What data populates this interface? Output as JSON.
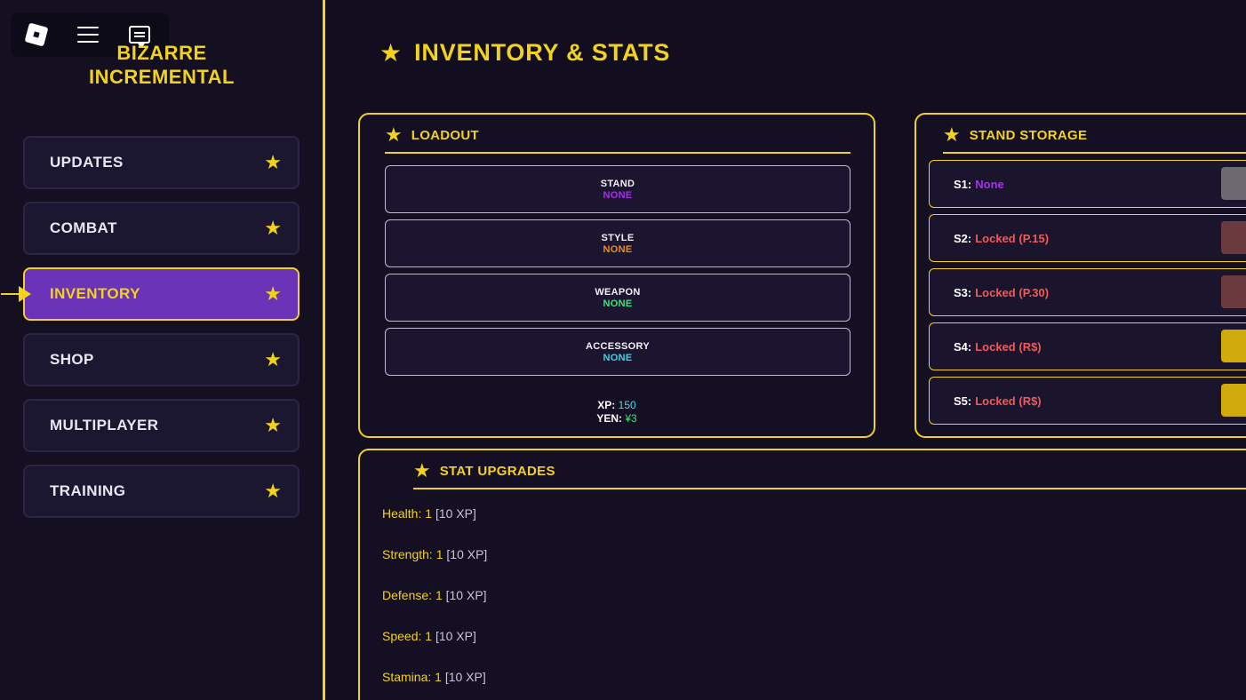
{
  "app": {
    "title": "BIZARRE INCREMENTAL"
  },
  "colors": {
    "accent": "#f2d21c",
    "active_nav": "#6a33b8",
    "background": "#120e1f",
    "stand_value": "#a72ff0",
    "style_value": "#f08b1a",
    "weapon_value": "#3ee37a",
    "accessory_value": "#35d6e0",
    "locked": "#f05a5a",
    "xp_value": "#55d8e8",
    "yen_value": "#3ee37a"
  },
  "topbar": {
    "icons": [
      "roblox-logo-icon",
      "menu-icon",
      "chat-icon"
    ]
  },
  "nav": {
    "items": [
      {
        "label": "UPDATES",
        "icon": "star-icon",
        "active": false
      },
      {
        "label": "COMBAT",
        "icon": "star-icon",
        "active": false
      },
      {
        "label": "INVENTORY",
        "icon": "star-icon",
        "active": true
      },
      {
        "label": "SHOP",
        "icon": "star-icon",
        "active": false
      },
      {
        "label": "MULTIPLAYER",
        "icon": "star-icon",
        "active": false
      },
      {
        "label": "TRAINING",
        "icon": "star-icon",
        "active": false
      }
    ]
  },
  "page": {
    "title": "INVENTORY & STATS"
  },
  "loadout": {
    "title": "LOADOUT",
    "slots": [
      {
        "label": "STAND",
        "value": "NONE"
      },
      {
        "label": "STYLE",
        "value": "NONE"
      },
      {
        "label": "WEAPON",
        "value": "NONE"
      },
      {
        "label": "ACCESSORY",
        "value": "NONE"
      }
    ],
    "xp_label": "XP:",
    "xp_value": "150",
    "yen_label": "YEN:",
    "yen_value": "¥3"
  },
  "storage": {
    "title": "STAND STORAGE",
    "slots": [
      {
        "key": "S1:",
        "value": "None",
        "button_color": "#6d6a72"
      },
      {
        "key": "S2:",
        "value": "Locked (P.15)",
        "button_color": "#6a3a3e"
      },
      {
        "key": "S3:",
        "value": "Locked (P.30)",
        "button_color": "#6a3a3e"
      },
      {
        "key": "S4:",
        "value": "Locked (R$)",
        "button_color": "#d1aa0c"
      },
      {
        "key": "S5:",
        "value": "Locked (R$)",
        "button_color": "#d1aa0c"
      }
    ]
  },
  "upgrades": {
    "title": "STAT UPGRADES",
    "stats": [
      {
        "name": "Health:",
        "level": "1",
        "cost": "[10 XP]"
      },
      {
        "name": "Strength:",
        "level": "1",
        "cost": "[10 XP]"
      },
      {
        "name": "Defense:",
        "level": "1",
        "cost": "[10 XP]"
      },
      {
        "name": "Speed:",
        "level": "1",
        "cost": "[10 XP]"
      },
      {
        "name": "Stamina:",
        "level": "1",
        "cost": "[10 XP]"
      }
    ]
  }
}
